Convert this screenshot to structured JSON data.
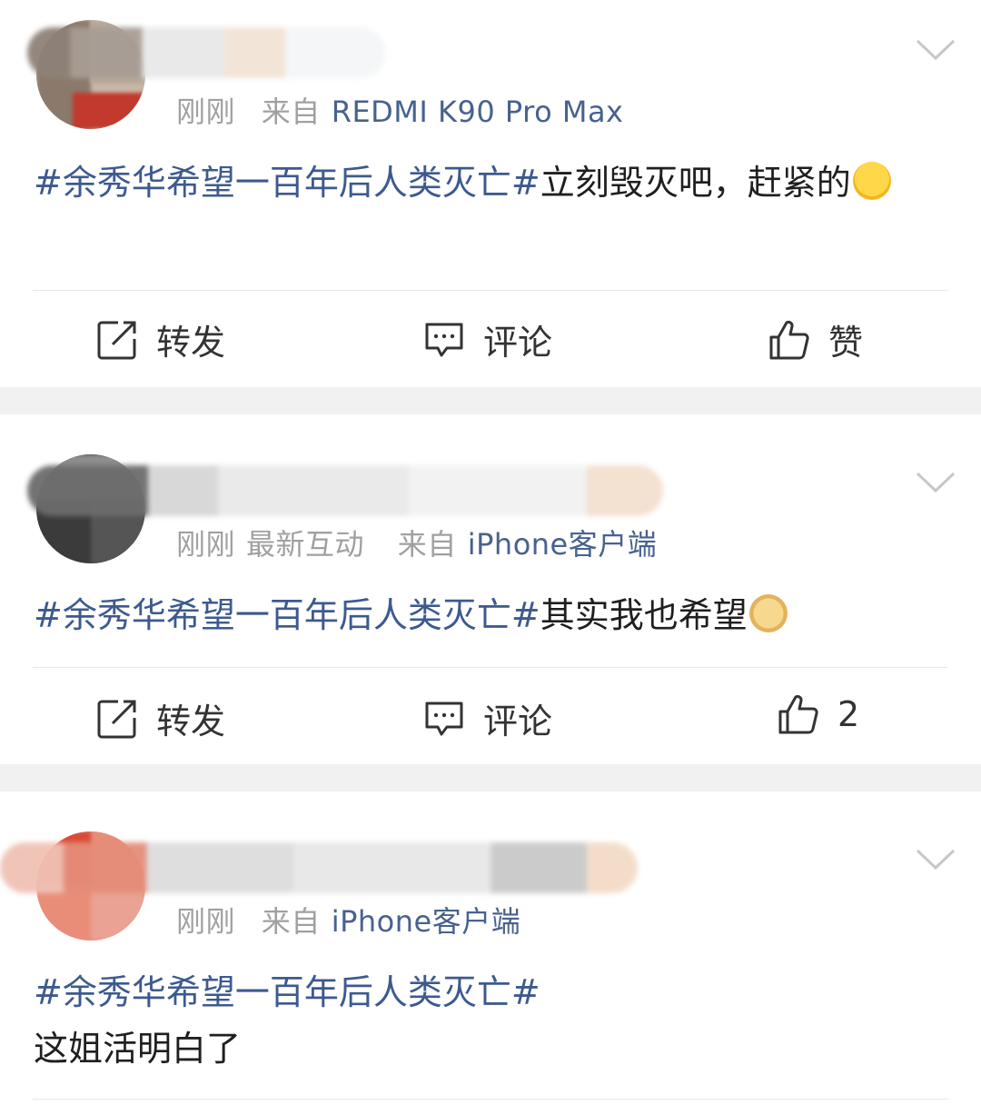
{
  "posts": [
    {
      "time": "刚刚",
      "extra": "",
      "source_prefix": "来自",
      "source": "REDMI K90 Pro Max",
      "topic": "#余秀华希望一百年后人类灭亡#",
      "text": "立刻毁灭吧，赶紧的",
      "emoji_icon": "laughing-cry-emoji",
      "actions": {
        "repost": "转发",
        "comment": "评论",
        "like": "赞"
      }
    },
    {
      "time": "刚刚",
      "extra": "最新互动",
      "source_prefix": "来自",
      "source": "iPhone客户端",
      "topic": "#余秀华希望一百年后人类灭亡#",
      "text": "其实我也希望",
      "emoji_icon": "doge-emoji",
      "actions": {
        "repost": "转发",
        "comment": "评论",
        "like": "2"
      }
    },
    {
      "time": "刚刚",
      "extra": "",
      "source_prefix": "来自",
      "source": "iPhone客户端",
      "topic": "#余秀华希望一百年后人类灭亡#",
      "text": "这姐活明白了"
    }
  ],
  "colors": {
    "topic": "#3d5a8f",
    "meta": "#a0a0a0",
    "separator": "#f1f1f1"
  }
}
